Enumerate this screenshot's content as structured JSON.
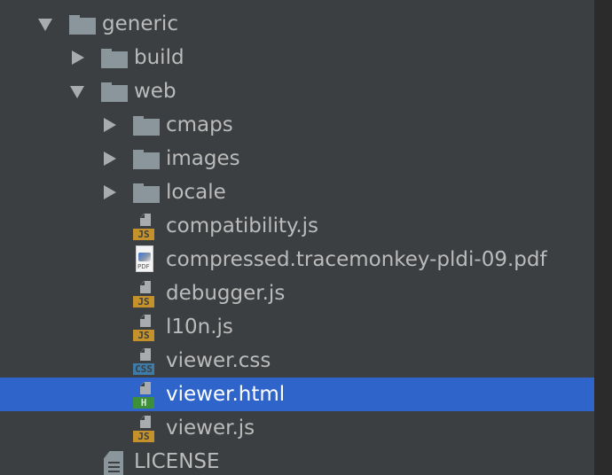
{
  "tree": {
    "root": {
      "label": "generic",
      "expanded": true
    },
    "build": {
      "label": "build",
      "expanded": false
    },
    "web": {
      "label": "web",
      "expanded": true
    },
    "folders": [
      {
        "label": "cmaps"
      },
      {
        "label": "images"
      },
      {
        "label": "locale"
      }
    ],
    "files": [
      {
        "label": "compatibility.js",
        "badge": "JS",
        "type": "js"
      },
      {
        "label": "compressed.tracemonkey-pldi-09.pdf",
        "badge": "PDF",
        "type": "pdf"
      },
      {
        "label": "debugger.js",
        "badge": "JS",
        "type": "js"
      },
      {
        "label": "l10n.js",
        "badge": "JS",
        "type": "js"
      },
      {
        "label": "viewer.css",
        "badge": "CSS",
        "type": "css"
      },
      {
        "label": "viewer.html",
        "badge": "H",
        "type": "html",
        "selected": true
      },
      {
        "label": "viewer.js",
        "badge": "JS",
        "type": "js"
      }
    ],
    "license": {
      "label": "LICENSE"
    }
  },
  "colors": {
    "background": "#3c3f41",
    "selection": "#2f65ca",
    "text": "#bbbbbb",
    "selected_text": "#ffffff",
    "js_badge": "#c5912b",
    "css_badge": "#3d7ba8",
    "html_badge": "#3d8f3a",
    "folder": "#8b959c"
  }
}
